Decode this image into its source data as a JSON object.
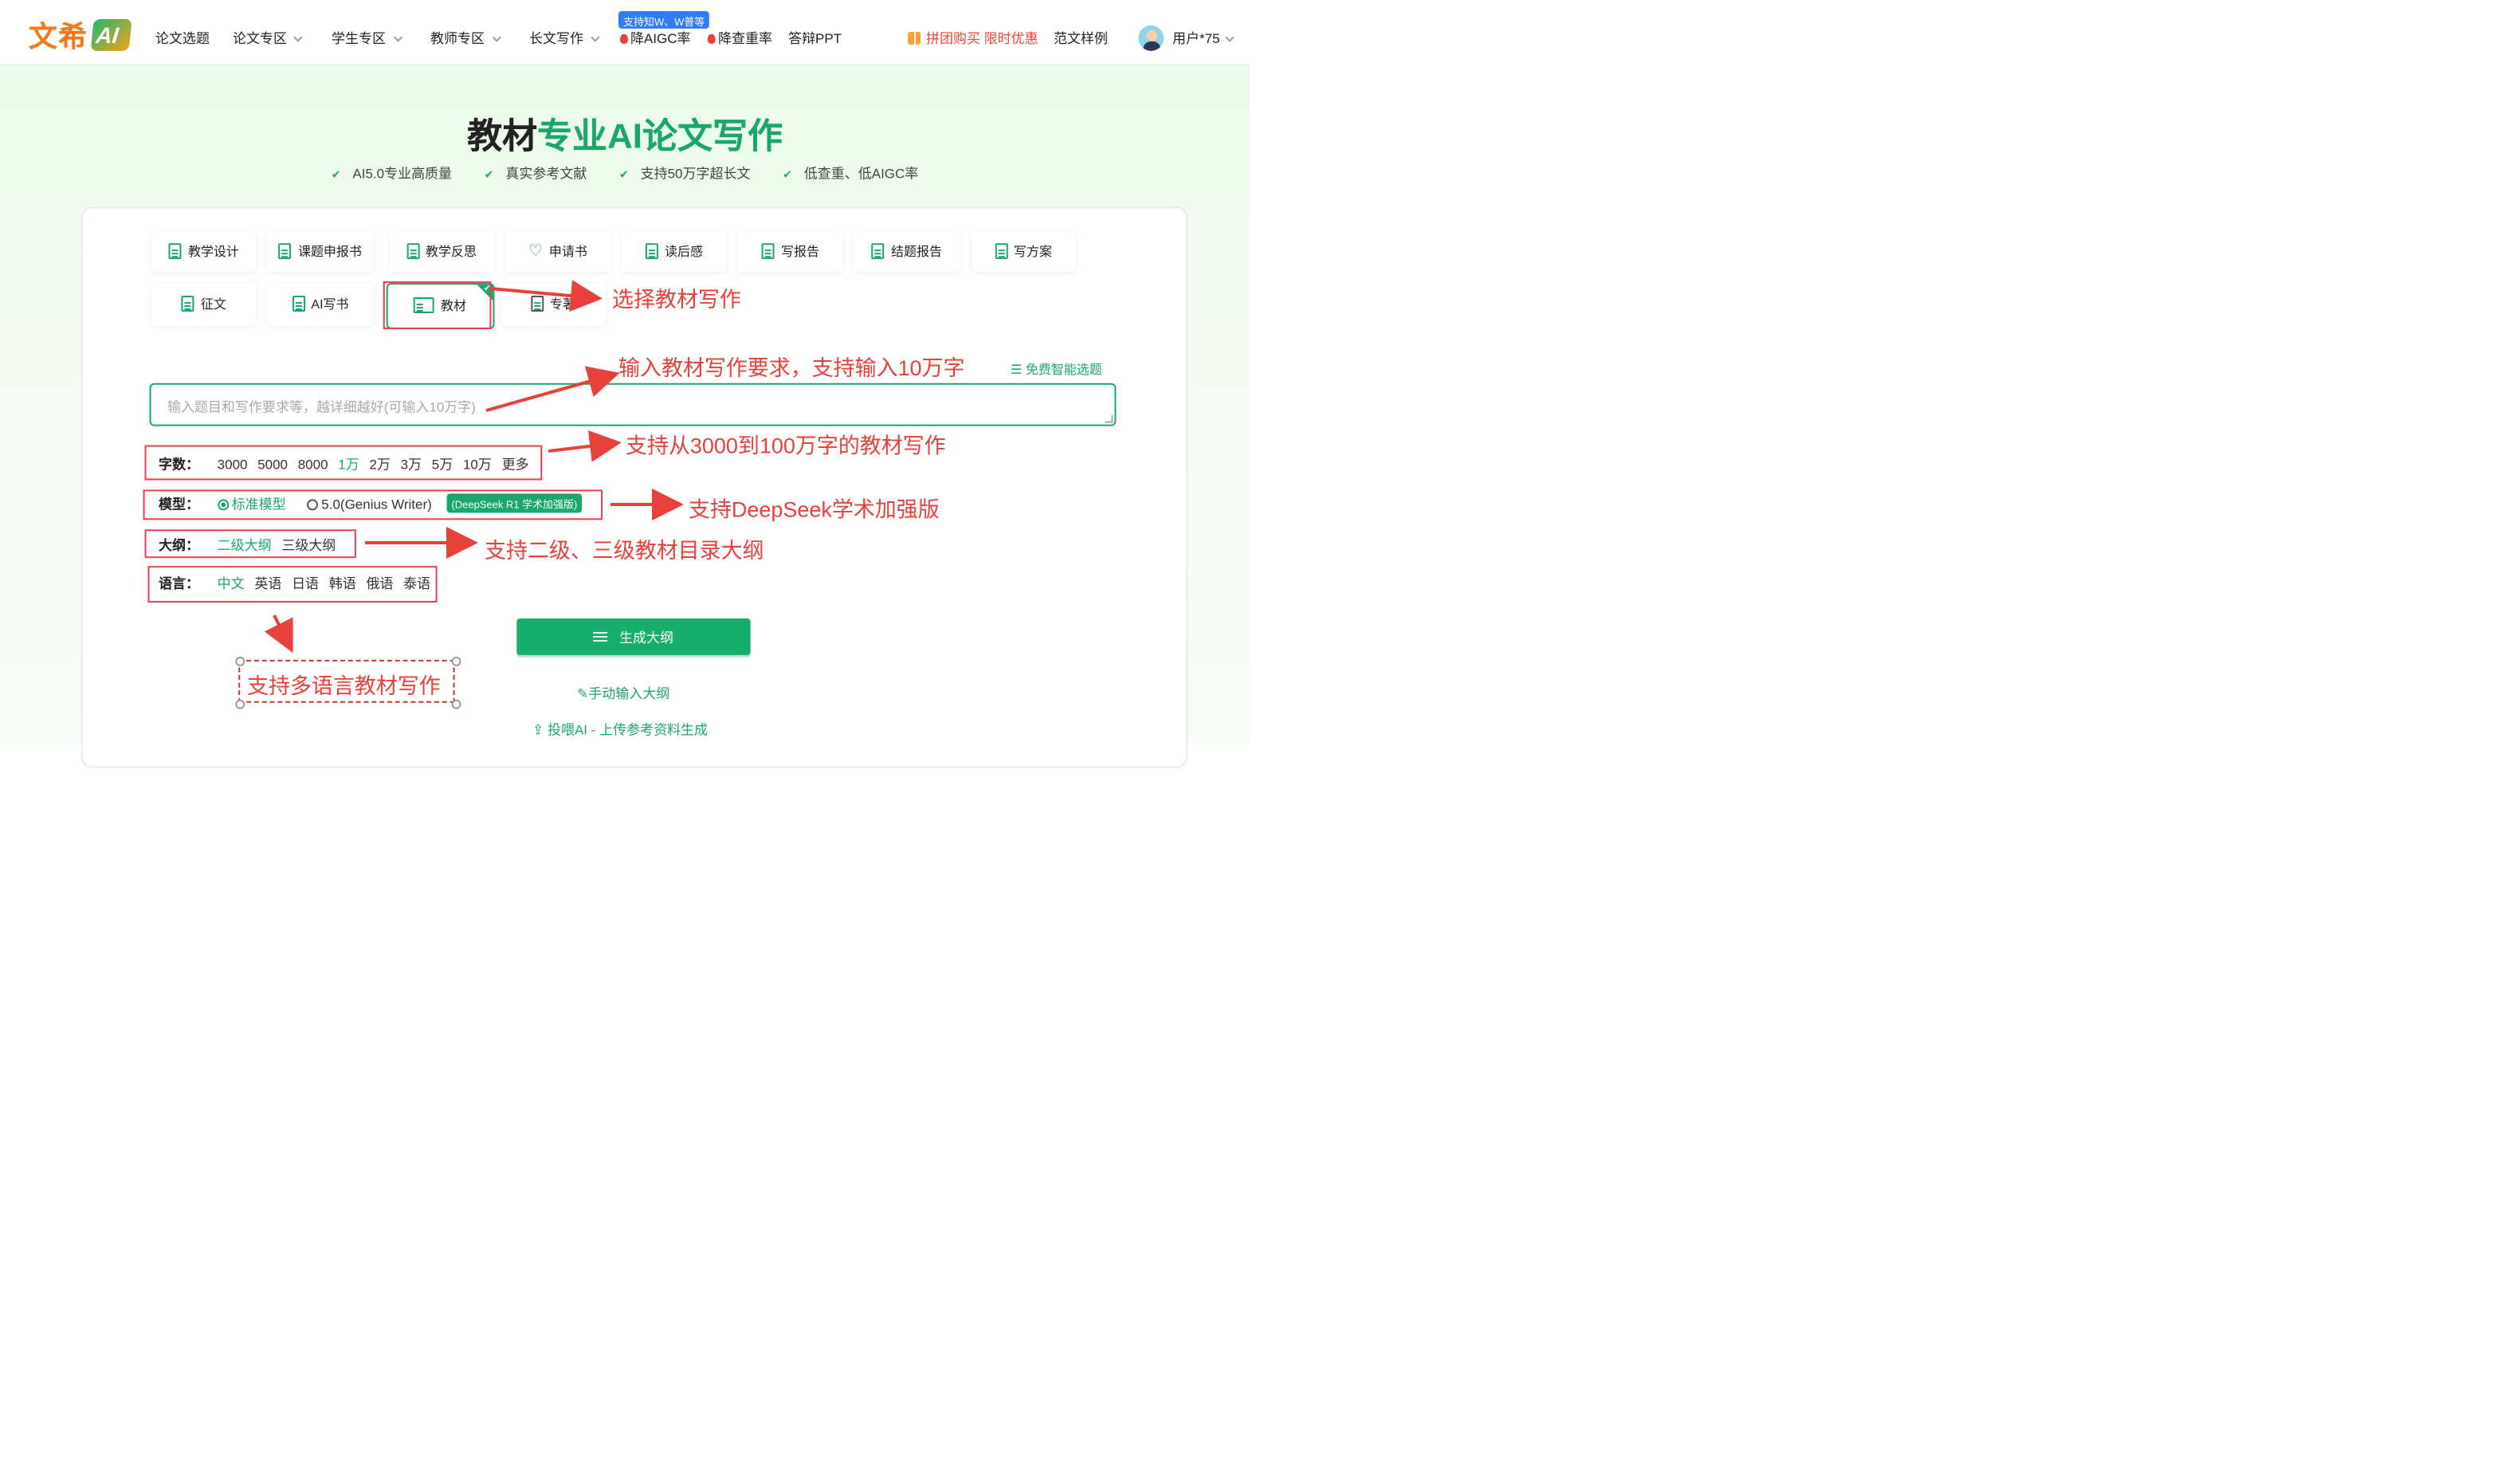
{
  "header": {
    "logo_text": "文希",
    "logo_badge": "AI",
    "nav": [
      {
        "label": "论文选题",
        "dropdown": false
      },
      {
        "label": "论文专区",
        "dropdown": true
      },
      {
        "label": "学生专区",
        "dropdown": true
      },
      {
        "label": "教师专区",
        "dropdown": true
      },
      {
        "label": "长文写作",
        "dropdown": true
      }
    ],
    "top_badge": "支持知W、W普等",
    "hot_links": [
      "降AIGC率",
      "降查重率"
    ],
    "defense_ppt": "答辩PPT",
    "promo": "拼团购买 限时优惠",
    "samples": "范文样例",
    "user": "用户*75"
  },
  "hero": {
    "title_dark": "教材",
    "title_green": "专业AI论文写作",
    "features": [
      "AI5.0专业高质量",
      "真实参考文献",
      "支持50万字超长文",
      "低查重、低AIGC率"
    ]
  },
  "categories": [
    {
      "label": "教学设计",
      "icon": "notebook-icon",
      "selected": false
    },
    {
      "label": "课题申报书",
      "icon": "clipboard-icon",
      "selected": false
    },
    {
      "label": "教学反思",
      "icon": "document-icon",
      "selected": false
    },
    {
      "label": "申请书",
      "icon": "heart-icon",
      "selected": false
    },
    {
      "label": "读后感",
      "icon": "calendar-icon",
      "selected": false
    },
    {
      "label": "写报告",
      "icon": "search-document-icon",
      "selected": false
    },
    {
      "label": "结题报告",
      "icon": "document-icon",
      "selected": false
    },
    {
      "label": "写方案",
      "icon": "document-icon",
      "selected": false
    },
    {
      "label": "征文",
      "icon": "clipboard-icon",
      "selected": false
    },
    {
      "label": "AI写书",
      "icon": "clipboard-icon",
      "selected": false
    },
    {
      "label": "教材",
      "icon": "open-book-icon",
      "selected": true
    },
    {
      "label": "专著",
      "icon": "book-icon",
      "selected": false
    }
  ],
  "smart_topic": "免费智能选题",
  "input": {
    "placeholder": "输入题目和写作要求等，越详细越好(可输入10万字)",
    "value": ""
  },
  "word_count": {
    "label": "字数：",
    "options": [
      "3000",
      "5000",
      "8000",
      "1万",
      "2万",
      "3万",
      "5万",
      "10万",
      "更多"
    ],
    "selected": "1万"
  },
  "model": {
    "label": "模型：",
    "options": [
      "标准模型",
      "5.0(Genius Writer)"
    ],
    "selected": "标准模型",
    "badge": "(DeepSeek R1 学术加强版)"
  },
  "outline": {
    "label": "大纲：",
    "options": [
      "二级大纲",
      "三级大纲"
    ],
    "selected": "二级大纲"
  },
  "language": {
    "label": "语言：",
    "options": [
      "中文",
      "英语",
      "日语",
      "韩语",
      "俄语",
      "泰语"
    ],
    "selected": "中文"
  },
  "actions": {
    "generate": "生成大纲",
    "manual": "手动输入大纲",
    "upload": "投喂AI - 上传参考资料生成"
  },
  "annotations": {
    "choose": "选择教材写作",
    "input": "输入教材写作要求，支持输入10万字",
    "words": "支持从3000到100万字的教材写作",
    "model": "支持DeepSeek学术加强版",
    "outline": "支持二级、三级教材目录大纲",
    "language": "支持多语言教材写作"
  },
  "colors": {
    "brand_green": "#1aa86a",
    "logo_orange": "#f07b1d",
    "annotation_red": "#e8413c",
    "promo_red": "#f0453a",
    "badge_blue": "#2f7cf6"
  }
}
